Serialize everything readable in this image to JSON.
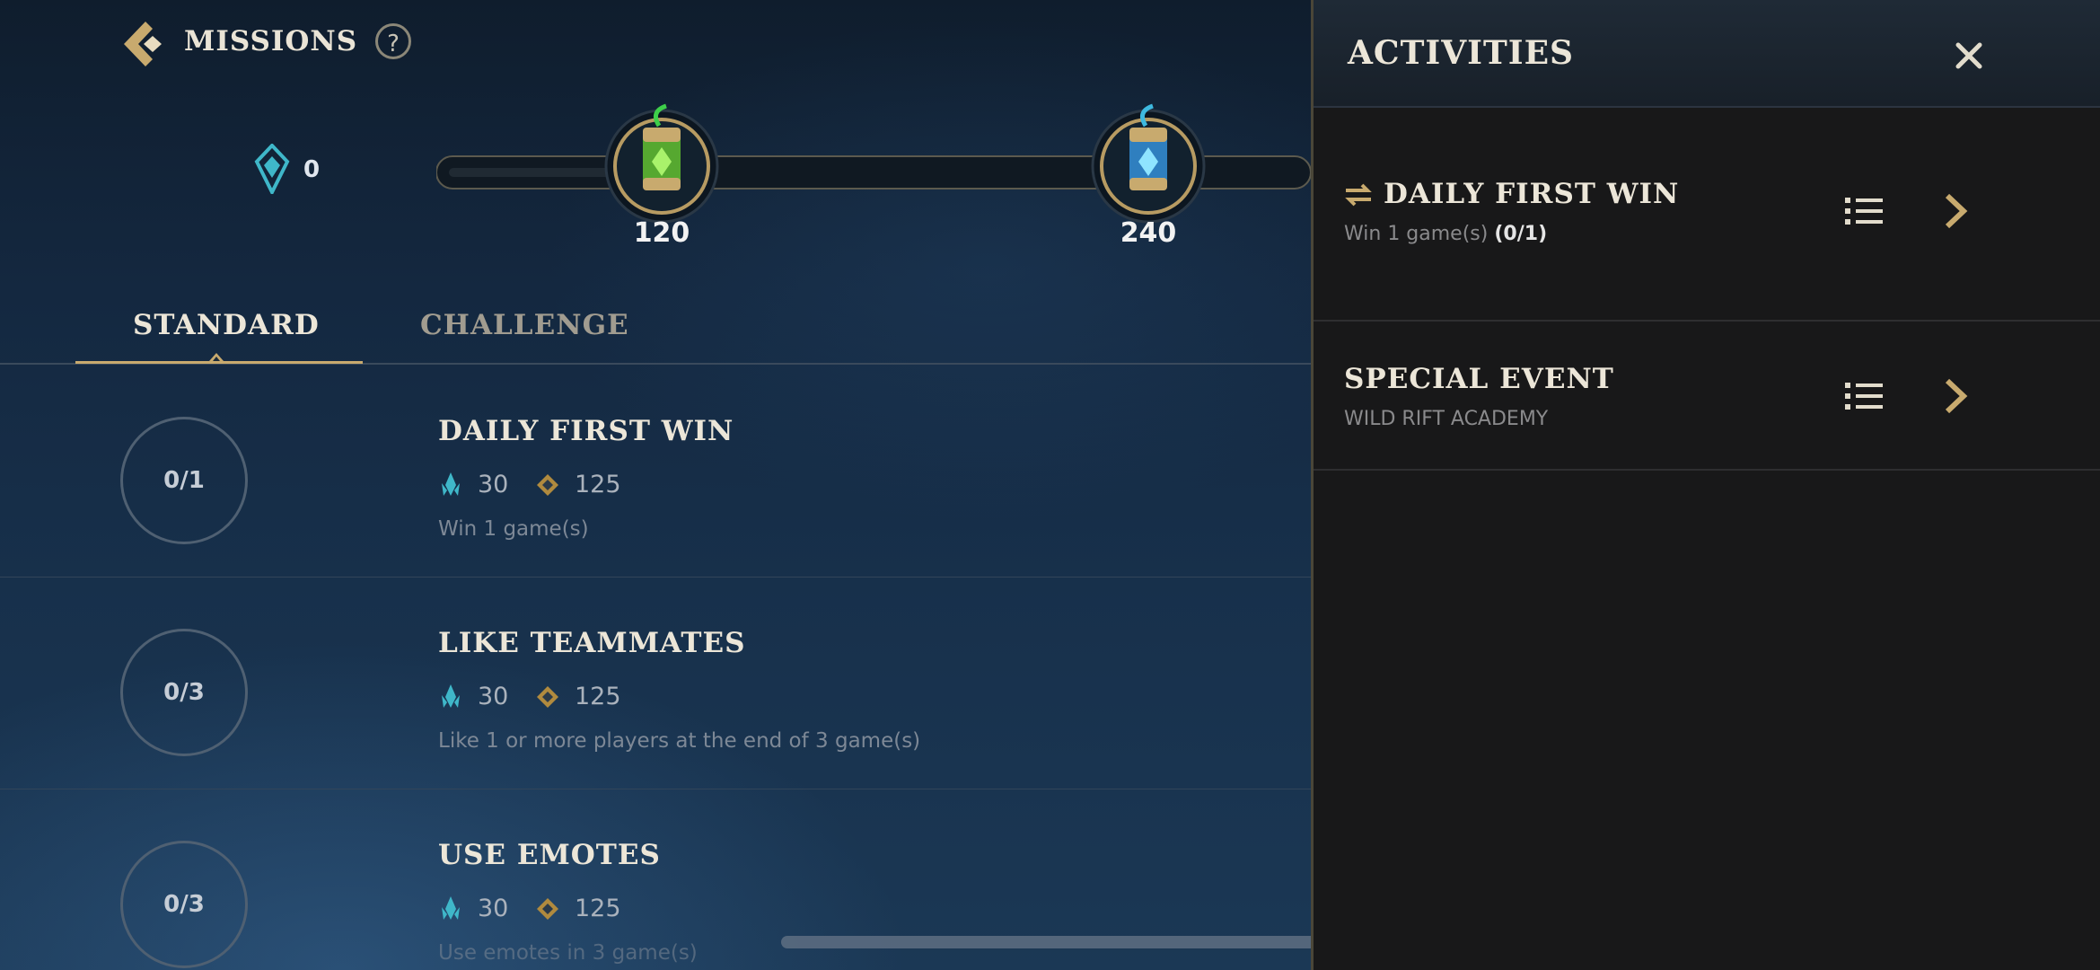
{
  "header": {
    "title": "MISSIONS",
    "help_symbol": "?",
    "back_icon": "chevron-left-icon"
  },
  "currency": {
    "icon": "wild-core-icon",
    "value": "0"
  },
  "progress": {
    "rewards": [
      {
        "value": "120",
        "icon": "green-chest-icon"
      },
      {
        "value": "240",
        "icon": "blue-chest-icon"
      }
    ]
  },
  "tabs": [
    {
      "label": "STANDARD",
      "active": true
    },
    {
      "label": "CHALLENGE",
      "active": false
    }
  ],
  "missions": [
    {
      "progress": "0/1",
      "title": "DAILY FIRST WIN",
      "reward_a": "30",
      "reward_b": "125",
      "description": "Win 1 game(s)"
    },
    {
      "progress": "0/3",
      "title": "LIKE TEAMMATES",
      "reward_a": "30",
      "reward_b": "125",
      "description": "Like 1 or more players at the end of 3 game(s)"
    },
    {
      "progress": "0/3",
      "title": "USE EMOTES",
      "reward_a": "30",
      "reward_b": "125",
      "description": "Use emotes in 3 game(s)"
    }
  ],
  "panel": {
    "title": "ACTIVITIES",
    "activities": [
      {
        "title": "DAILY FIRST WIN",
        "subtitle": "Win 1 game(s)",
        "progress": "(0/1)",
        "icon": "swap-arrows-icon"
      },
      {
        "title": "SPECIAL EVENT",
        "subtitle": "WILD RIFT ACADEMY"
      }
    ]
  },
  "colors": {
    "gold": "#c8aa6e",
    "text_light": "#ece6d8",
    "teal": "#3fb7c9"
  }
}
